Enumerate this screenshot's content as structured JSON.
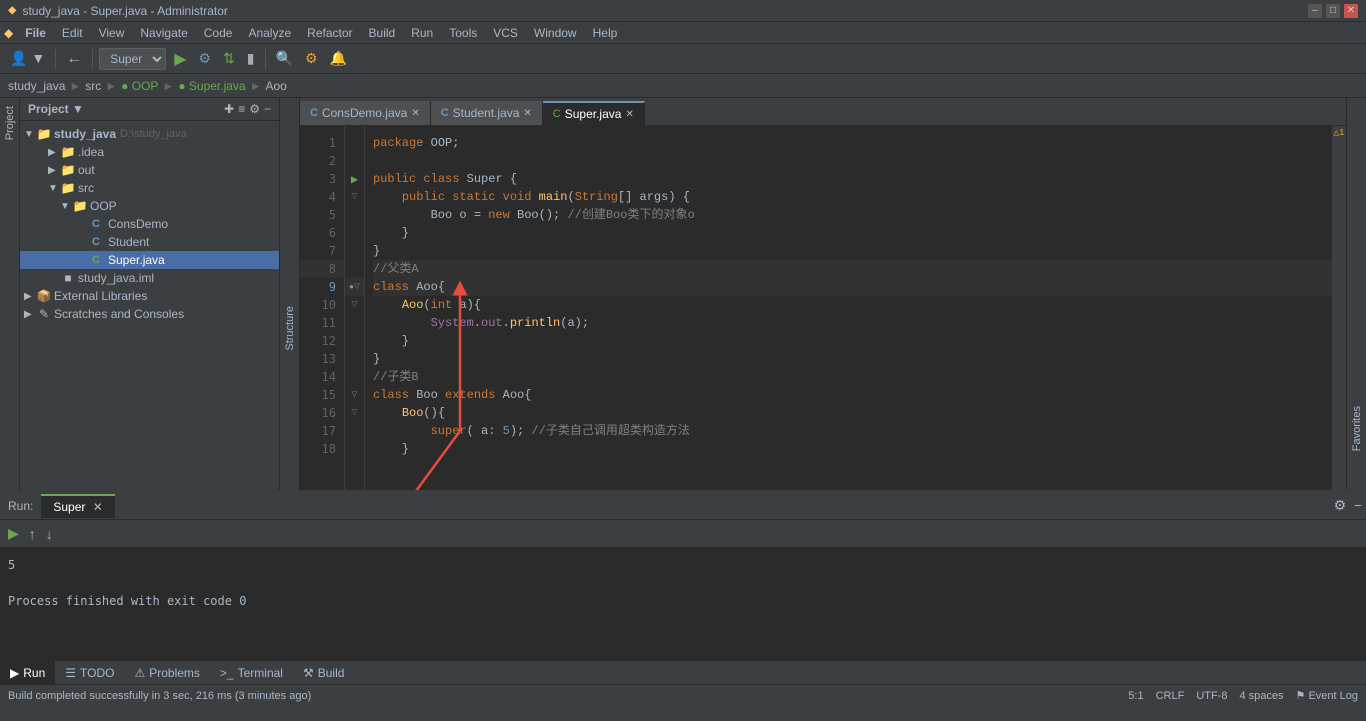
{
  "titlebar": {
    "title": "study_java - Super.java - Administrator",
    "icon": "idea-icon",
    "controls": [
      "minimize",
      "maximize",
      "close"
    ]
  },
  "menubar": {
    "items": [
      "File",
      "Edit",
      "View",
      "Navigate",
      "Code",
      "Analyze",
      "Refactor",
      "Build",
      "Run",
      "Tools",
      "VCS",
      "Window",
      "Help"
    ]
  },
  "toolbar": {
    "breadcrumb": [
      "study_java",
      "src",
      "OOP",
      "Super.java",
      "Aoo"
    ]
  },
  "sidebar": {
    "header": "Project",
    "tree": [
      {
        "id": "study_java",
        "label": "study_java",
        "extra": "D:\\study_java",
        "level": 0,
        "type": "root",
        "expanded": true
      },
      {
        "id": "idea",
        "label": ".idea",
        "level": 1,
        "type": "folder",
        "expanded": false
      },
      {
        "id": "out",
        "label": "out",
        "level": 1,
        "type": "folder-yellow",
        "expanded": false
      },
      {
        "id": "src",
        "label": "src",
        "level": 1,
        "type": "folder",
        "expanded": true
      },
      {
        "id": "oop",
        "label": "OOP",
        "level": 2,
        "type": "folder",
        "expanded": true
      },
      {
        "id": "consdemo",
        "label": "ConsDemo",
        "level": 3,
        "type": "java-c"
      },
      {
        "id": "student",
        "label": "Student",
        "level": 3,
        "type": "java-c"
      },
      {
        "id": "super",
        "label": "Super.java",
        "level": 3,
        "type": "java-c",
        "selected": true
      },
      {
        "id": "iml",
        "label": "study_java.iml",
        "level": 1,
        "type": "iml"
      },
      {
        "id": "extlibs",
        "label": "External Libraries",
        "level": 0,
        "type": "libs",
        "expanded": false
      },
      {
        "id": "scratches",
        "label": "Scratches and Consoles",
        "level": 0,
        "type": "scratches",
        "expanded": false
      }
    ]
  },
  "tabs": [
    {
      "label": "ConsDemo.java",
      "type": "c",
      "active": false
    },
    {
      "label": "Student.java",
      "type": "c",
      "active": false
    },
    {
      "label": "Super.java",
      "type": "super",
      "active": true
    }
  ],
  "code": {
    "lines": [
      {
        "num": 1,
        "content": "package OOP;",
        "tokens": [
          {
            "t": "kw",
            "v": "package"
          },
          {
            "t": "plain",
            "v": " OOP;"
          }
        ]
      },
      {
        "num": 2,
        "content": "",
        "tokens": []
      },
      {
        "num": 3,
        "content": "public class Super {",
        "tokens": [
          {
            "t": "kw",
            "v": "public"
          },
          {
            "t": "plain",
            "v": " "
          },
          {
            "t": "kw",
            "v": "class"
          },
          {
            "t": "plain",
            "v": " Super {"
          }
        ],
        "fold": true
      },
      {
        "num": 4,
        "content": "    public static void main(String[] args) {",
        "tokens": [
          {
            "t": "kw",
            "v": "    public"
          },
          {
            "t": "plain",
            "v": " "
          },
          {
            "t": "kw",
            "v": "static"
          },
          {
            "t": "plain",
            "v": " "
          },
          {
            "t": "kw",
            "v": "void"
          },
          {
            "t": "plain",
            "v": " "
          },
          {
            "t": "fn",
            "v": "main"
          },
          {
            "t": "plain",
            "v": "("
          },
          {
            "t": "kw",
            "v": "String"
          },
          {
            "t": "plain",
            "v": "[] args) {"
          }
        ],
        "fold": true
      },
      {
        "num": 5,
        "content": "        Boo o = new Boo(); //创建Boo类下的对象o",
        "tokens": [
          {
            "t": "plain",
            "v": "        Boo o = "
          },
          {
            "t": "kw",
            "v": "new"
          },
          {
            "t": "plain",
            "v": " Boo(); "
          },
          {
            "t": "cmt",
            "v": "//创建Boo类下的对象o"
          }
        ]
      },
      {
        "num": 6,
        "content": "    }",
        "tokens": [
          {
            "t": "plain",
            "v": "    }"
          }
        ]
      },
      {
        "num": 7,
        "content": "}",
        "tokens": [
          {
            "t": "plain",
            "v": "}"
          }
        ]
      },
      {
        "num": 8,
        "content": "//父类A",
        "tokens": [
          {
            "t": "cmt",
            "v": "//父类A"
          }
        ],
        "highlighted": true
      },
      {
        "num": 9,
        "content": "class Aoo{",
        "tokens": [
          {
            "t": "kw",
            "v": "class"
          },
          {
            "t": "plain",
            "v": " Aoo{"
          }
        ],
        "active": true,
        "fold": true
      },
      {
        "num": 10,
        "content": "    Aoo(int a){",
        "tokens": [
          {
            "t": "plain",
            "v": "    "
          },
          {
            "t": "fn",
            "v": "Aoo"
          },
          {
            "t": "plain",
            "v": "("
          },
          {
            "t": "kw",
            "v": "int"
          },
          {
            "t": "plain",
            "v": " a){"
          }
        ],
        "fold": true
      },
      {
        "num": 11,
        "content": "        System.out.println(a);",
        "tokens": [
          {
            "t": "plain",
            "v": "        "
          },
          {
            "t": "sys",
            "v": "System"
          },
          {
            "t": "plain",
            "v": "."
          },
          {
            "t": "sys",
            "v": "out"
          },
          {
            "t": "plain",
            "v": "."
          },
          {
            "t": "fn",
            "v": "println"
          },
          {
            "t": "plain",
            "v": "(a);"
          }
        ]
      },
      {
        "num": 12,
        "content": "    }",
        "tokens": [
          {
            "t": "plain",
            "v": "    }"
          }
        ]
      },
      {
        "num": 13,
        "content": "}",
        "tokens": [
          {
            "t": "plain",
            "v": "}"
          }
        ]
      },
      {
        "num": 14,
        "content": "//子类B",
        "tokens": [
          {
            "t": "cmt",
            "v": "//子类B"
          }
        ]
      },
      {
        "num": 15,
        "content": "class Boo extends Aoo{",
        "tokens": [
          {
            "t": "kw",
            "v": "class"
          },
          {
            "t": "plain",
            "v": " Boo "
          },
          {
            "t": "kw",
            "v": "extends"
          },
          {
            "t": "plain",
            "v": " Aoo{"
          }
        ],
        "fold": true
      },
      {
        "num": 16,
        "content": "    Boo(){",
        "tokens": [
          {
            "t": "plain",
            "v": "    "
          },
          {
            "t": "fn",
            "v": "Boo"
          },
          {
            "t": "plain",
            "v": "(){"
          }
        ],
        "fold": true
      },
      {
        "num": 17,
        "content": "        super( a: 5); //子类自己调用超类构造方法",
        "tokens": [
          {
            "t": "plain",
            "v": "        "
          },
          {
            "t": "kw",
            "v": "super"
          },
          {
            "t": "plain",
            "v": "( a: "
          },
          {
            "t": "num",
            "v": "5"
          },
          {
            "t": "plain",
            "v": "); "
          },
          {
            "t": "cmt",
            "v": "//子类自己调用超类构造方法"
          }
        ]
      },
      {
        "num": 18,
        "content": "    }",
        "tokens": [
          {
            "t": "plain",
            "v": "    }"
          }
        ]
      }
    ]
  },
  "run_panel": {
    "label": "Run:",
    "tab_label": "Super",
    "output": [
      "5",
      "",
      "Process finished with exit code 0"
    ]
  },
  "bottom_nav": [
    {
      "label": "Run",
      "icon": "▶",
      "active": true
    },
    {
      "label": "TODO",
      "icon": "≡"
    },
    {
      "label": "Problems",
      "icon": "⚠"
    },
    {
      "label": "Terminal",
      "icon": ">_"
    },
    {
      "label": "Build",
      "icon": "⚒"
    }
  ],
  "status_bar": {
    "message": "Build completed successfully in 3 sec, 216 ms (3 minutes ago)",
    "position": "5:1",
    "encoding": "CRLF",
    "charset": "UTF-8",
    "indent": "4 spaces",
    "event_log": "Event Log"
  },
  "colors": {
    "accent_blue": "#6897bb",
    "accent_green": "#6aa84f",
    "keyword": "#cc7832",
    "comment": "#808080",
    "string": "#6a8759",
    "number": "#6897bb",
    "sys_color": "#9876aa",
    "fn_color": "#ffc66d"
  }
}
